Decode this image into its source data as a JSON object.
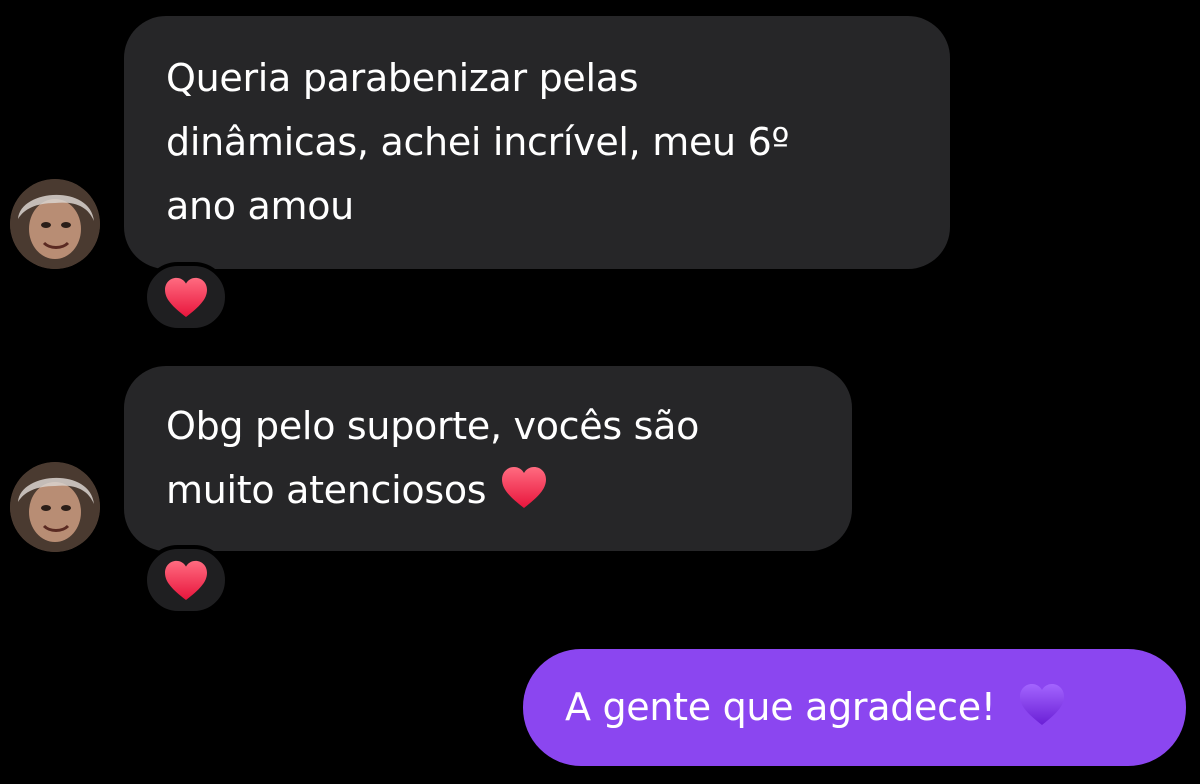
{
  "messages": [
    {
      "direction": "incoming",
      "lines": [
        "Queria parabenizar pelas",
        "dinâmicas, achei incrível, meu 6º",
        "ano amou"
      ],
      "reaction_icon": "red-heart",
      "has_avatar": true
    },
    {
      "direction": "incoming",
      "lines": [
        "Obg pelo suporte, vocês são",
        "muito atenciosos"
      ],
      "trailing_emoji": "red-heart",
      "reaction_icon": "red-heart",
      "has_avatar": true
    },
    {
      "direction": "outgoing",
      "text": "A gente que agradece!",
      "trailing_emoji": "purple-heart"
    }
  ],
  "colors": {
    "background": "#000000",
    "incoming_bubble": "#262628",
    "outgoing_bubble": "#8b46f0",
    "text": "#ffffff",
    "red_heart": "#f0324f",
    "purple_heart": "#7a2ee0"
  }
}
